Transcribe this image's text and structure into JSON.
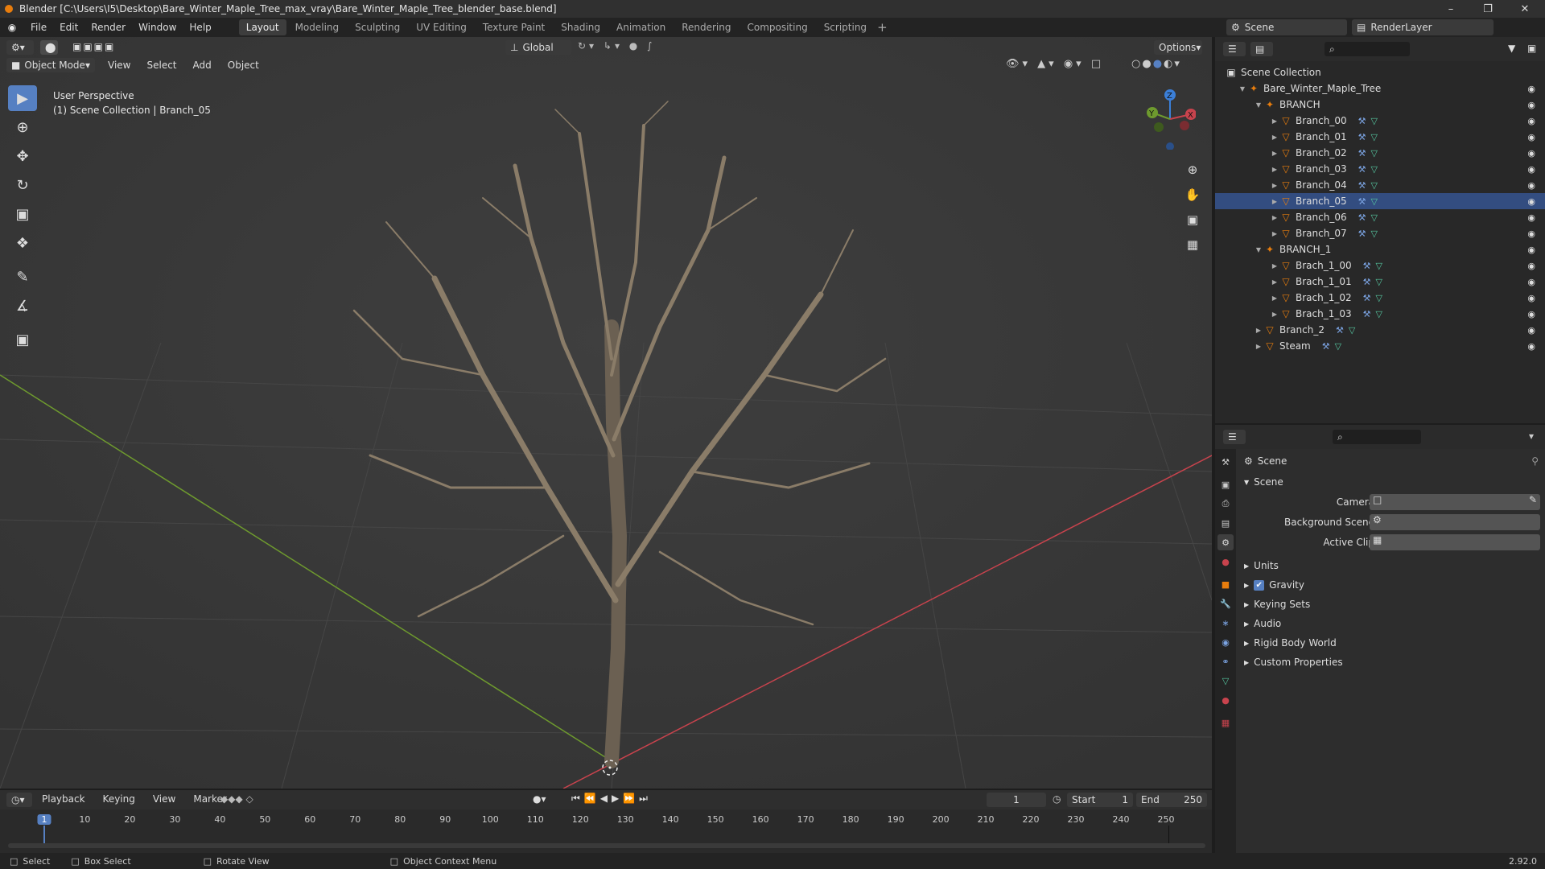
{
  "window": {
    "title": "Blender [C:\\Users\\I5\\Desktop\\Bare_Winter_Maple_Tree_max_vray\\Bare_Winter_Maple_Tree_blender_base.blend]",
    "minimize": "–",
    "maximize": "❐",
    "close": "✕"
  },
  "menu": {
    "items": [
      "File",
      "Edit",
      "Render",
      "Window",
      "Help"
    ]
  },
  "workspaces": {
    "tabs": [
      "Layout",
      "Modeling",
      "Sculpting",
      "UV Editing",
      "Texture Paint",
      "Shading",
      "Animation",
      "Rendering",
      "Compositing",
      "Scripting"
    ],
    "active": "Layout",
    "add": "+"
  },
  "topright": {
    "scene": "Scene",
    "view_layer": "RenderLayer"
  },
  "viewport": {
    "orientation": "Global",
    "options": "Options",
    "mode": "Object Mode",
    "menus": [
      "View",
      "Select",
      "Add",
      "Object"
    ],
    "overlay_line1": "User Perspective",
    "overlay_line2": "(1) Scene Collection | Branch_05",
    "gizmo": {
      "x": "X",
      "y": "Y",
      "z": "Z"
    }
  },
  "outliner": {
    "root": "Scene Collection",
    "rows": [
      {
        "label": "Bare_Winter_Maple_Tree",
        "depth": 0,
        "kind": "empty",
        "expanded": true
      },
      {
        "label": "BRANCH",
        "depth": 1,
        "kind": "empty",
        "expanded": true
      },
      {
        "label": "Branch_00",
        "depth": 2,
        "kind": "mesh"
      },
      {
        "label": "Branch_01",
        "depth": 2,
        "kind": "mesh"
      },
      {
        "label": "Branch_02",
        "depth": 2,
        "kind": "mesh"
      },
      {
        "label": "Branch_03",
        "depth": 2,
        "kind": "mesh"
      },
      {
        "label": "Branch_04",
        "depth": 2,
        "kind": "mesh"
      },
      {
        "label": "Branch_05",
        "depth": 2,
        "kind": "mesh",
        "selected": true
      },
      {
        "label": "Branch_06",
        "depth": 2,
        "kind": "mesh"
      },
      {
        "label": "Branch_07",
        "depth": 2,
        "kind": "mesh"
      },
      {
        "label": "BRANCH_1",
        "depth": 1,
        "kind": "empty",
        "expanded": true
      },
      {
        "label": "Brach_1_00",
        "depth": 2,
        "kind": "mesh"
      },
      {
        "label": "Brach_1_01",
        "depth": 2,
        "kind": "mesh"
      },
      {
        "label": "Brach_1_02",
        "depth": 2,
        "kind": "mesh"
      },
      {
        "label": "Brach_1_03",
        "depth": 2,
        "kind": "mesh"
      },
      {
        "label": "Branch_2",
        "depth": 1,
        "kind": "mesh"
      },
      {
        "label": "Steam",
        "depth": 1,
        "kind": "mesh"
      }
    ]
  },
  "properties": {
    "context": "Scene",
    "panel": "Scene",
    "camera_label": "Camera",
    "background_label": "Background Scene",
    "clip_label": "Active Clip",
    "sections": [
      "Units",
      "Gravity",
      "Keying Sets",
      "Audio",
      "Rigid Body World",
      "Custom Properties"
    ],
    "gravity_checked": true
  },
  "timeline": {
    "menus": [
      "Playback",
      "Keying",
      "View",
      "Marker"
    ],
    "current_frame": "1",
    "start_label": "Start",
    "start": "1",
    "end_label": "End",
    "end": "250",
    "ticks": [
      "1",
      "10",
      "20",
      "30",
      "40",
      "50",
      "60",
      "70",
      "80",
      "90",
      "100",
      "110",
      "120",
      "130",
      "140",
      "150",
      "160",
      "170",
      "180",
      "190",
      "200",
      "210",
      "220",
      "230",
      "240",
      "250"
    ]
  },
  "status": {
    "select": "Select",
    "box_select": "Box Select",
    "rotate": "Rotate View",
    "context": "Object Context Menu",
    "version": "2.92.0"
  },
  "colors": {
    "accent": "#5680c2",
    "orange": "#e87d0d",
    "x_axis": "#c8434d",
    "y_axis": "#6e9a2e",
    "z_axis": "#3b7fd8"
  }
}
